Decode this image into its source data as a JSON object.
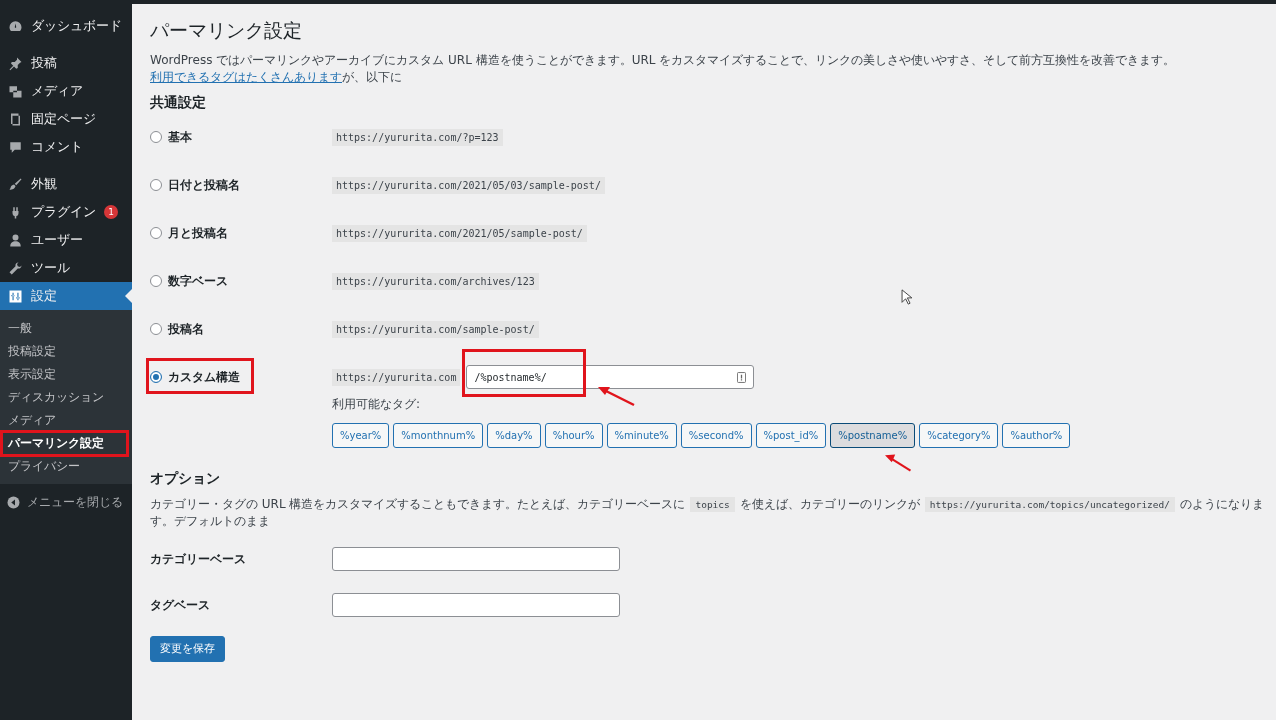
{
  "sidebar": {
    "items": [
      {
        "label": "ダッシュボード",
        "selected": false
      },
      {
        "label": "投稿",
        "selected": false
      },
      {
        "label": "メディア",
        "selected": false
      },
      {
        "label": "固定ページ",
        "selected": false
      },
      {
        "label": "コメント",
        "selected": false
      },
      {
        "label": "外観",
        "selected": false
      },
      {
        "label": "プラグイン",
        "selected": false,
        "badge": "1"
      },
      {
        "label": "ユーザー",
        "selected": false
      },
      {
        "label": "ツール",
        "selected": false
      },
      {
        "label": "設定",
        "selected": true,
        "children": [
          {
            "label": "一般",
            "selected": false,
            "highlighted": false
          },
          {
            "label": "投稿設定",
            "selected": false,
            "highlighted": false
          },
          {
            "label": "表示設定",
            "selected": false,
            "highlighted": false
          },
          {
            "label": "ディスカッション",
            "selected": false,
            "highlighted": false
          },
          {
            "label": "メディア",
            "selected": false,
            "highlighted": false
          },
          {
            "label": "パーマリンク設定",
            "selected": true,
            "highlighted": true
          },
          {
            "label": "プライバシー",
            "selected": false,
            "highlighted": false
          }
        ]
      }
    ],
    "collapse": "メニューを閉じる"
  },
  "page_title": "パーマリンク設定",
  "intro": {
    "text": "WordPress ではパーマリンクやアーカイブにカスタム URL 構造を使うことができます。URL をカスタマイズすることで、リンクの美しさや使いやすさ、そして前方互換性を改善できます。",
    "link": "利用できるタグはたくさんあります",
    "tail": "が、以下に"
  },
  "common_heading": "共通設定",
  "options": [
    {
      "label": "基本",
      "example": "https://yururita.com/?p=123",
      "selected": false,
      "highlighted": false
    },
    {
      "label": "日付と投稿名",
      "example": "https://yururita.com/2021/05/03/sample-post/",
      "selected": false,
      "highlighted": false
    },
    {
      "label": "月と投稿名",
      "example": "https://yururita.com/2021/05/sample-post/",
      "selected": false,
      "highlighted": false
    },
    {
      "label": "数字ベース",
      "example": "https://yururita.com/archives/123",
      "selected": false,
      "highlighted": false
    },
    {
      "label": "投稿名",
      "example": "https://yururita.com/sample-post/",
      "selected": false,
      "highlighted": false
    },
    {
      "label": "カスタム構造",
      "example": "https://yururita.com",
      "selected": true,
      "highlighted": true,
      "value": "/%postname%/"
    }
  ],
  "custom_input": {
    "highlighted": true,
    "arrow": true
  },
  "tags_label": "利用可能なタグ:",
  "tags": [
    {
      "label": "%year%",
      "selected": false,
      "arrow": false
    },
    {
      "label": "%monthnum%",
      "selected": false,
      "arrow": false
    },
    {
      "label": "%day%",
      "selected": false,
      "arrow": false
    },
    {
      "label": "%hour%",
      "selected": false,
      "arrow": false
    },
    {
      "label": "%minute%",
      "selected": false,
      "arrow": false
    },
    {
      "label": "%second%",
      "selected": false,
      "arrow": false
    },
    {
      "label": "%post_id%",
      "selected": false,
      "arrow": false
    },
    {
      "label": "%postname%",
      "selected": true,
      "arrow": true
    },
    {
      "label": "%category%",
      "selected": false,
      "arrow": false
    },
    {
      "label": "%author%",
      "selected": false,
      "arrow": false
    }
  ],
  "options_heading": "オプション",
  "options_text": {
    "a": "カテゴリー・タグの URL 構造をカスタマイズすることもできます。たとえば、カテゴリーベースに",
    "code1": "topics",
    "b": "を使えば、カテゴリーのリンクが",
    "code2": "https://yururita.com/topics/uncategorized/",
    "c": "のようになります。デフォルトのまま"
  },
  "fields": [
    {
      "label": "カテゴリーベース"
    },
    {
      "label": "タグベース"
    }
  ],
  "save_button": "変更を保存"
}
